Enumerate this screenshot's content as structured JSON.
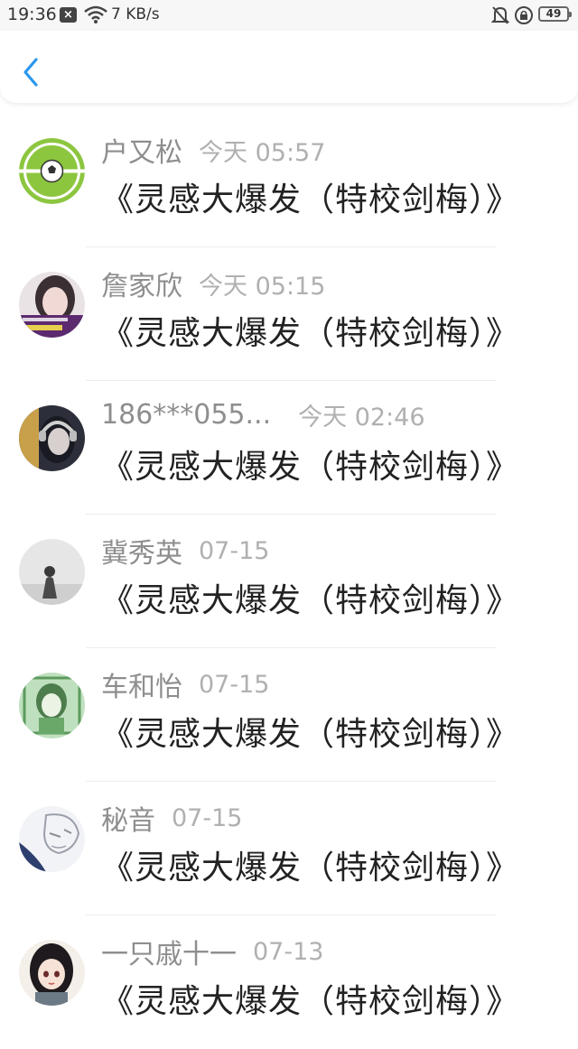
{
  "status_bar": {
    "time": "19:36",
    "network_speed": "7 KB/s",
    "battery": "49",
    "icons": [
      "notification-x-icon",
      "wifi-icon",
      "bell-muted-icon",
      "rotation-lock-icon",
      "battery-icon"
    ]
  },
  "header": {
    "back_icon": "chevron-left-icon",
    "accent_color": "#2a97f0"
  },
  "items": [
    {
      "name": "户又松",
      "time": "今天 05:57",
      "title": "《灵感大爆发（特校剑梅）》",
      "avatar": "soccer-ball-avatar"
    },
    {
      "name": "詹家欣",
      "time": "今天 05:15",
      "title": "《灵感大爆发（特校剑梅）》",
      "avatar": "girl-photo-avatar"
    },
    {
      "name": "186***055...",
      "time": "今天 02:46",
      "title": "《灵感大爆发（特校剑梅）》",
      "avatar": "headphones-girl-avatar"
    },
    {
      "name": "冀秀英",
      "time": "07-15",
      "title": "《灵感大爆发（特校剑梅）》",
      "avatar": "grayscale-figure-avatar"
    },
    {
      "name": "车和怡",
      "time": "07-15",
      "title": "《灵感大爆发（特校剑梅）》",
      "avatar": "green-anime-avatar"
    },
    {
      "name": "秘音",
      "time": "07-15",
      "title": "《灵感大爆发（特校剑梅）》",
      "avatar": "sketch-anime-avatar"
    },
    {
      "name": "一只戚十一",
      "time": "07-13",
      "title": "《灵感大爆发（特校剑梅）》",
      "avatar": "anime-girl-avatar"
    }
  ]
}
